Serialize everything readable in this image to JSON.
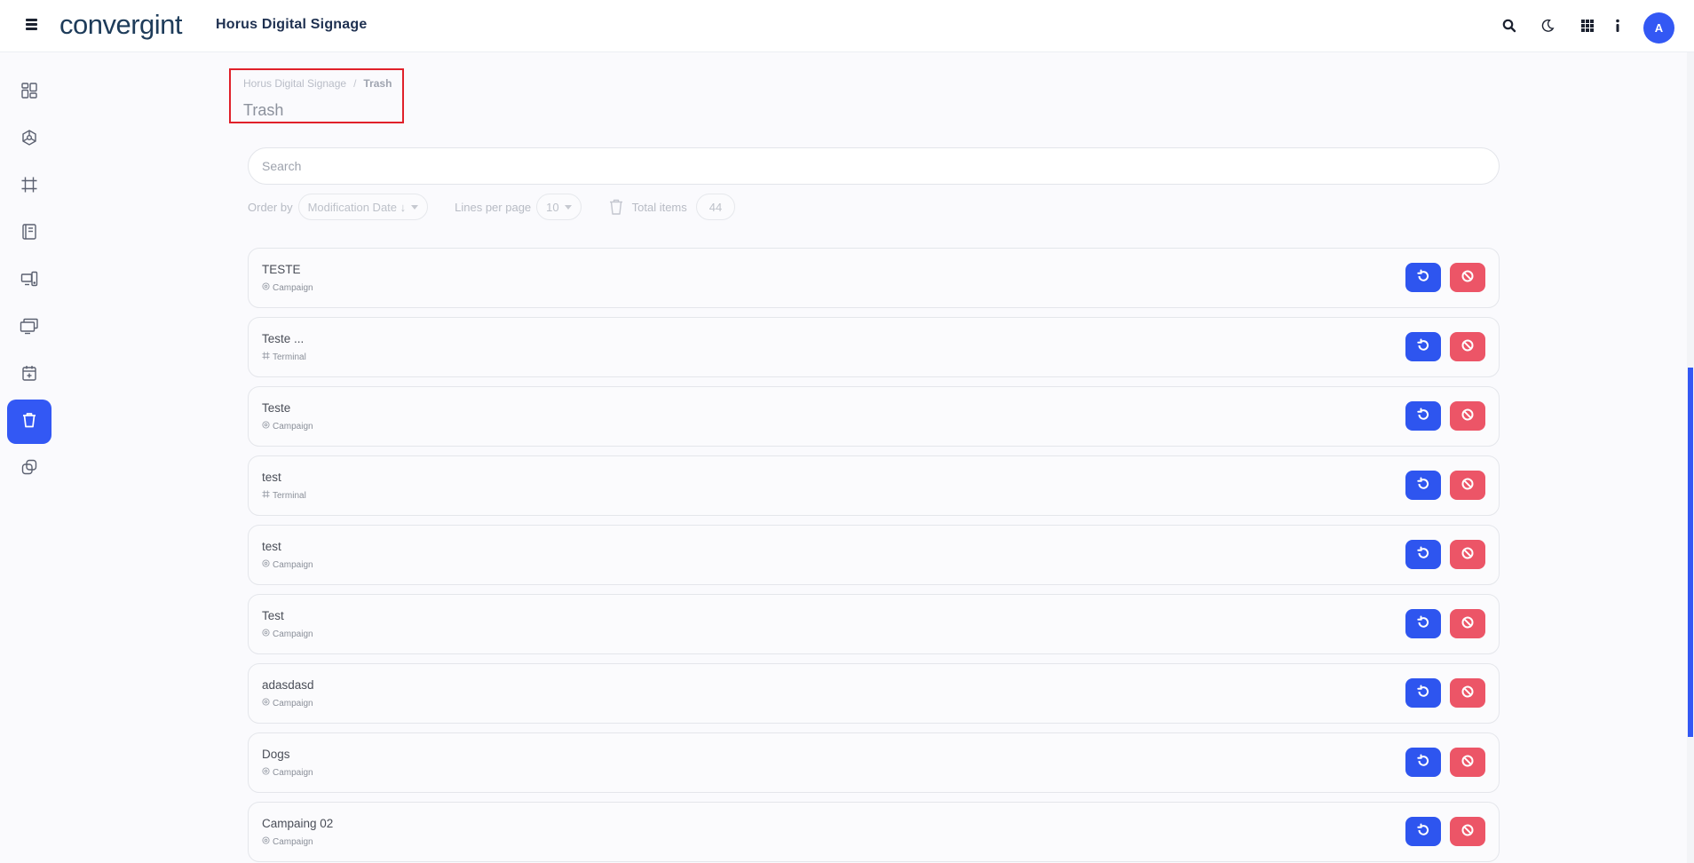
{
  "header": {
    "brand": "convergint",
    "app_title": "Horus Digital Signage",
    "avatar_initial": "A",
    "icons": [
      "search-icon",
      "moon-icon",
      "apps-grid-icon",
      "info-icon"
    ]
  },
  "sidebar": {
    "items": [
      {
        "icon": "dashboard-icon"
      },
      {
        "icon": "campaign-icon"
      },
      {
        "icon": "frame-icon"
      },
      {
        "icon": "content-icon"
      },
      {
        "icon": "devices-icon"
      },
      {
        "icon": "screens-icon"
      },
      {
        "icon": "calendar-add-icon"
      },
      {
        "icon": "trash-icon",
        "active": true
      },
      {
        "icon": "copy-icon"
      }
    ]
  },
  "breadcrumb": {
    "root": "Horus Digital Signage",
    "separator": "/",
    "current": "Trash"
  },
  "page": {
    "title": "Trash"
  },
  "search": {
    "placeholder": "Search",
    "value": ""
  },
  "filters": {
    "order_by_label": "Order by",
    "order_by_value": "Modification Date ↓",
    "lines_per_page_label": "Lines per page",
    "lines_per_page_value": "10",
    "total_items_label": "Total items",
    "total_items_value": "44"
  },
  "items": [
    {
      "title": "TESTE",
      "type": "Campaign"
    },
    {
      "title": "Teste ...",
      "type": "Terminal"
    },
    {
      "title": "Teste",
      "type": "Campaign"
    },
    {
      "title": "test",
      "type": "Terminal"
    },
    {
      "title": "test",
      "type": "Campaign"
    },
    {
      "title": "Test",
      "type": "Campaign"
    },
    {
      "title": "adasdasd",
      "type": "Campaign"
    },
    {
      "title": "Dogs",
      "type": "Campaign"
    },
    {
      "title": "Campaing 02",
      "type": "Campaign"
    }
  ],
  "colors": {
    "accent": "#3358f4",
    "restore": "#2e55ef",
    "delete": "#ec5567",
    "highlight": "#e0202a"
  }
}
